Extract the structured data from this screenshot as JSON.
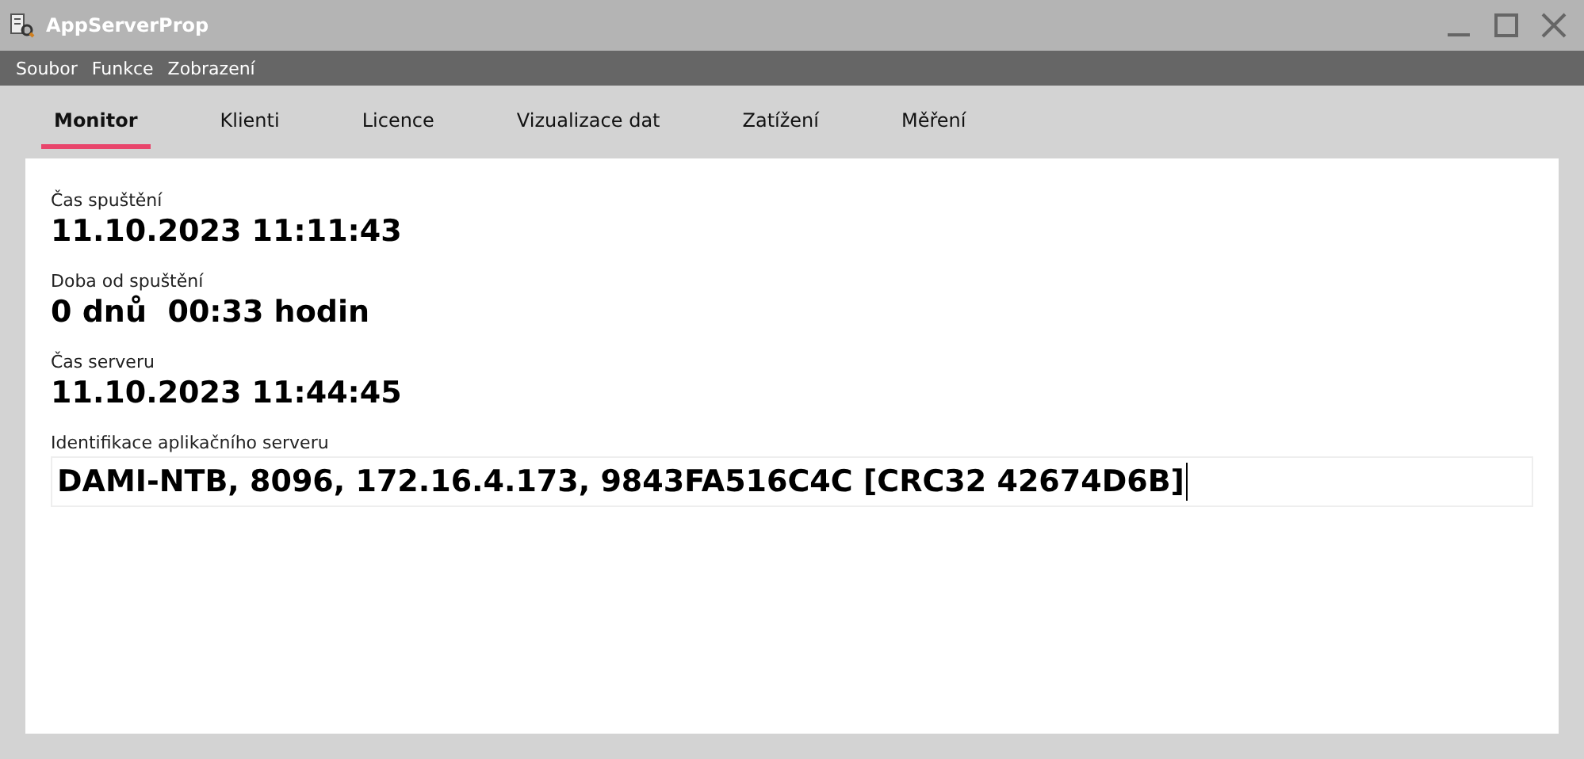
{
  "window": {
    "title": "AppServerProp"
  },
  "menu": [
    "Soubor",
    "Funkce",
    "Zobrazení"
  ],
  "tabs": [
    {
      "label": "Monitor",
      "selected": true
    },
    {
      "label": "Klienti",
      "selected": false
    },
    {
      "label": "Licence",
      "selected": false
    },
    {
      "label": "Vizualizace dat",
      "selected": false
    },
    {
      "label": "Zatížení",
      "selected": false
    },
    {
      "label": "Měření",
      "selected": false
    }
  ],
  "fields": [
    {
      "kind": "value",
      "label": "Čas spuštění",
      "value": "11.10.2023 11:11:43"
    },
    {
      "kind": "value",
      "label": "Doba od spuštění",
      "value": "0 dnů  00:33 hodin"
    },
    {
      "kind": "value",
      "label": "Čas serveru",
      "value": "11.10.2023 11:44:45"
    },
    {
      "kind": "input",
      "label": "Identifikace aplikačního serveru",
      "value": "DAMI-NTB, 8096, 172.16.4.173, 9843FA516C4C [CRC32 42674D6B]"
    }
  ]
}
